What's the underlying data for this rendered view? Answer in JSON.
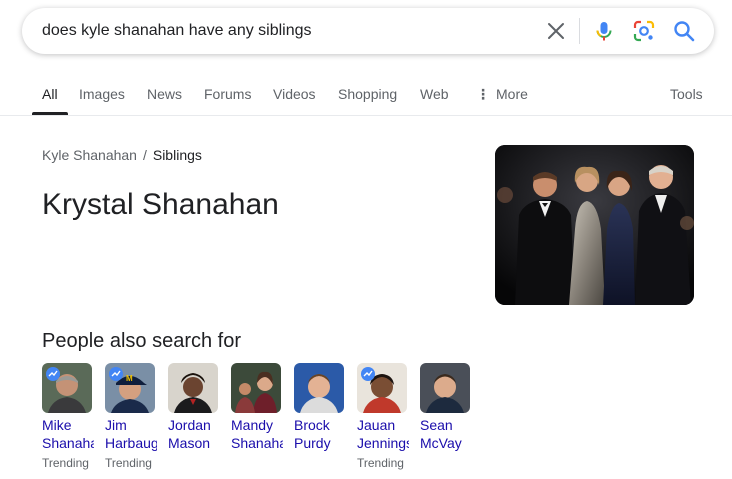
{
  "search": {
    "query": "does kyle shanahan have any siblings"
  },
  "tabs": [
    {
      "label": "All",
      "active": true
    },
    {
      "label": "Images"
    },
    {
      "label": "News"
    },
    {
      "label": "Forums"
    },
    {
      "label": "Videos"
    },
    {
      "label": "Shopping"
    },
    {
      "label": "Web"
    },
    {
      "label": "More"
    }
  ],
  "tools_label": "Tools",
  "breadcrumb": {
    "parent": "Kyle Shanahan",
    "separator": "/",
    "current": "Siblings"
  },
  "answer": {
    "title": "Krystal Shanahan"
  },
  "people_also_search": {
    "heading": "People also search for",
    "people": [
      {
        "first": "Mike",
        "last": "Shanahan",
        "trending": "Trending"
      },
      {
        "first": "Jim",
        "last": "Harbaugh",
        "trending": "Trending"
      },
      {
        "first": "Jordan",
        "last": "Mason",
        "trending": ""
      },
      {
        "first": "Mandy",
        "last": "Shanahan",
        "trending": ""
      },
      {
        "first": "Brock",
        "last": "Purdy",
        "trending": ""
      },
      {
        "first": "Jauan",
        "last": "Jennings",
        "trending": "Trending"
      },
      {
        "first": "Sean",
        "last": "McVay",
        "trending": ""
      }
    ]
  },
  "colors": {
    "link": "#1a0dab",
    "google_blue": "#4285f4",
    "google_red": "#ea4335",
    "google_yellow": "#fbbc05",
    "google_green": "#34a853"
  }
}
